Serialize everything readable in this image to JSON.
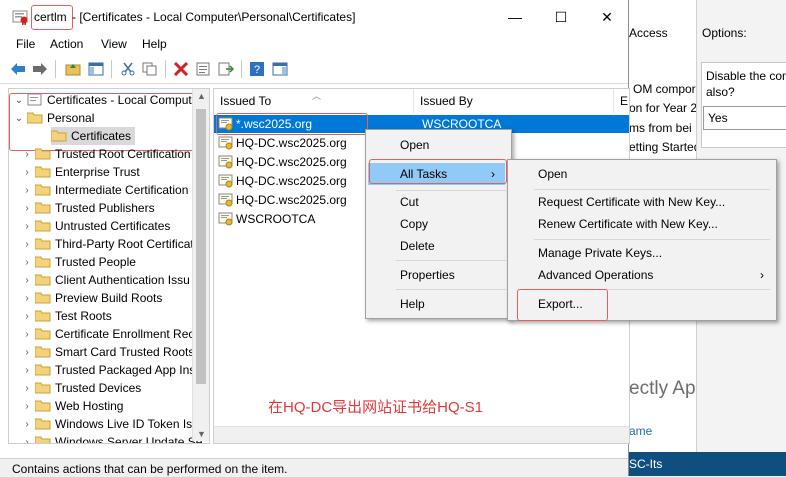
{
  "window": {
    "app_name": "certlm",
    "title_rest": " - [Certificates - Local Computer\\Personal\\Certificates]",
    "controls": {
      "minimize": "—",
      "maximize": "☐",
      "close": "✕"
    }
  },
  "menubar": [
    "File",
    "Action",
    "View",
    "Help"
  ],
  "toolbar_icons": [
    "back-icon",
    "forward-icon",
    "up-folder-icon",
    "show-hide-console-tree-icon",
    "cut-icon",
    "copy-icon",
    "delete-icon",
    "properties-icon",
    "export-list-icon",
    "help-icon",
    "show-action-pane-icon"
  ],
  "tree": {
    "root": "Certificates - Local Computer",
    "personal": "Personal",
    "personal_child": "Certificates",
    "stores": [
      "Trusted Root Certification",
      "Enterprise Trust",
      "Intermediate Certification",
      "Trusted Publishers",
      "Untrusted Certificates",
      "Third-Party Root Certificat",
      "Trusted People",
      "Client Authentication Issu",
      "Preview Build Roots",
      "Test Roots",
      "Certificate Enrollment Rec",
      "Smart Card Trusted Roots",
      "Trusted Packaged App Ins",
      "Trusted Devices",
      "Web Hosting",
      "Windows Live ID Token Iss",
      "Windows Server Update Se"
    ]
  },
  "list": {
    "columns": [
      "Issued To",
      "Issued By",
      "E"
    ],
    "rows": [
      {
        "issued_to": "*.wsc2025.org",
        "issued_by": "WSCROOTCA",
        "selected": true
      },
      {
        "issued_to": "HQ-DC.wsc2025.org",
        "issued_by": "",
        "selected": false
      },
      {
        "issued_to": "HQ-DC.wsc2025.org",
        "issued_by": "",
        "selected": false
      },
      {
        "issued_to": "HQ-DC.wsc2025.org",
        "issued_by": "",
        "selected": false
      },
      {
        "issued_to": "HQ-DC.wsc2025.org",
        "issued_by": "",
        "selected": false
      },
      {
        "issued_to": "WSCROOTCA",
        "issued_by": "",
        "selected": false
      }
    ]
  },
  "context_menu": {
    "open": "Open",
    "all_tasks": "All Tasks",
    "cut": "Cut",
    "copy": "Copy",
    "delete": "Delete",
    "properties": "Properties",
    "help": "Help"
  },
  "submenu": {
    "open": "Open",
    "request_new_key": "Request Certificate with New Key...",
    "renew_new_key": "Renew Certificate with New Key...",
    "manage_private_keys": "Manage Private Keys...",
    "advanced_operations": "Advanced Operations",
    "export": "Export..."
  },
  "status_bar": "Contains actions that can be performed on the item.",
  "annotation": "在HQ-DC导出网站证书给HQ-S1",
  "background_window": {
    "access": "Access",
    "options_label": "Options:",
    "disable_text_1": "Disable the com",
    "disable_text_2": "also?",
    "select_value": "Yes",
    "line1": "OM compor",
    "line2": "on for Year 20",
    "line3": "ms from bei",
    "line4": "etting Started",
    "big_text": "ectly App",
    "name_label": "ame",
    "footer": "SC-Its"
  },
  "colors": {
    "selection": "#0078d7",
    "menu_highlight": "#91c9f7",
    "annotation_red": "#e23a3a",
    "footer_blue": "#0f4f7f"
  }
}
